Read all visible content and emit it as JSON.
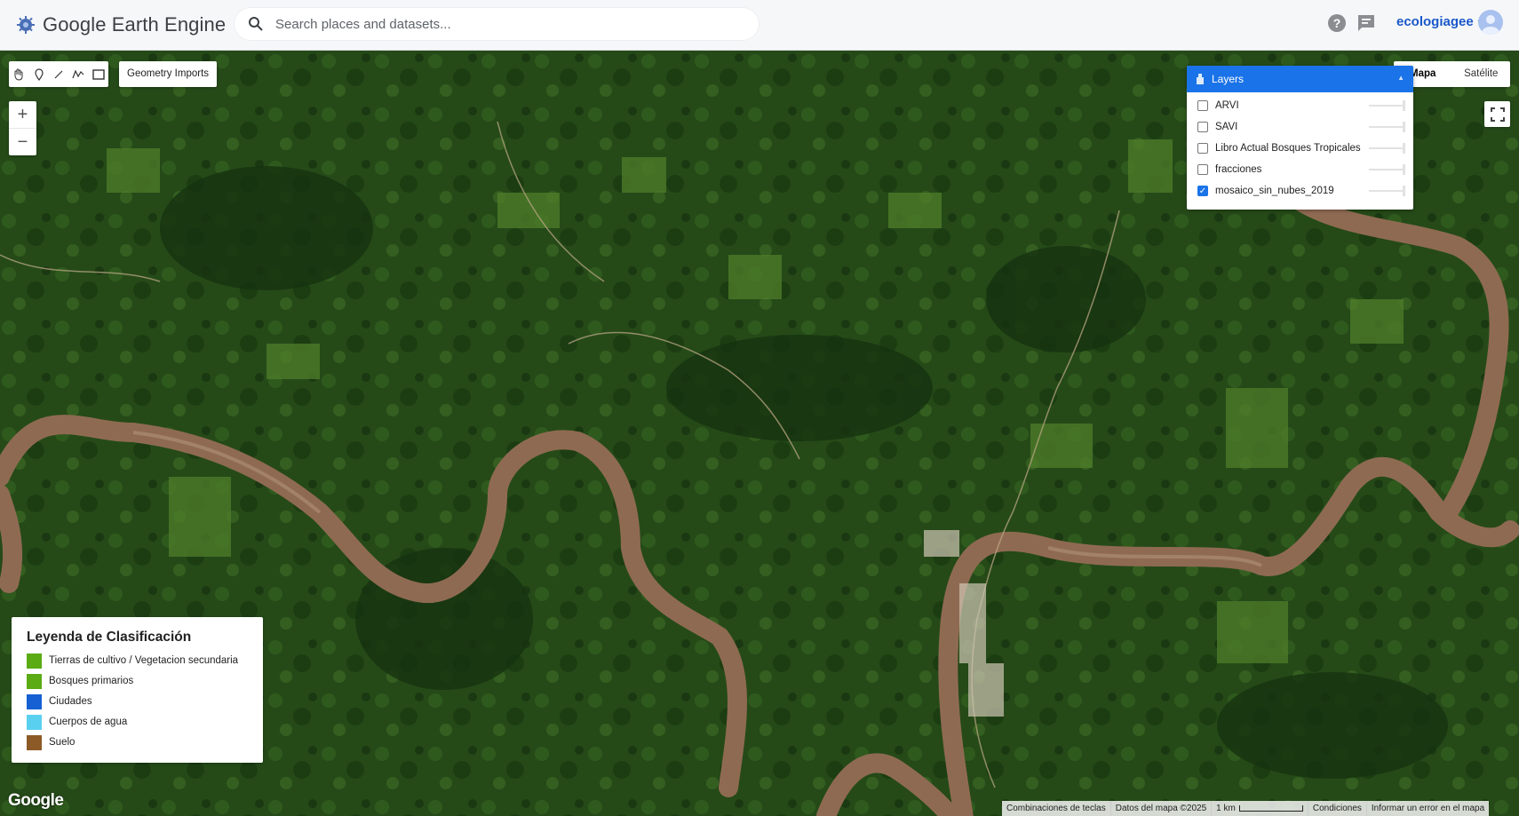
{
  "app": {
    "title": "Google Earth Engine",
    "search_placeholder": "Search places and datasets...",
    "account_name": "ecologiagee",
    "accent_color": "#1a73e8"
  },
  "toolbar": {
    "tools": [
      "pan-hand-icon",
      "point-marker-icon",
      "line-icon",
      "polygon-icon",
      "rectangle-icon"
    ],
    "geometry_imports_label": "Geometry Imports"
  },
  "zoom": {
    "in_label": "+",
    "out_label": "−"
  },
  "map_type": {
    "options": [
      "Mapa",
      "Satélite"
    ],
    "selected": "Mapa"
  },
  "layers": {
    "title": "Layers",
    "items": [
      {
        "name": "ARVI",
        "checked": false
      },
      {
        "name": "SAVI",
        "checked": false
      },
      {
        "name": "Libro Actual Bosques Tropicales",
        "checked": false
      },
      {
        "name": "fracciones",
        "checked": false
      },
      {
        "name": "mosaico_sin_nubes_2019",
        "checked": true
      }
    ]
  },
  "legend": {
    "title": "Leyenda de Clasificación",
    "items": [
      {
        "label": "Tierras de cultivo / Vegetacion secundaria",
        "color": "#5aab14"
      },
      {
        "label": "Bosques primarios",
        "color": "#5aab14"
      },
      {
        "label": "Ciudades",
        "color": "#1660d4"
      },
      {
        "label": "Cuerpos de agua",
        "color": "#5ad0f0"
      },
      {
        "label": "Suelo",
        "color": "#8c5a26"
      }
    ]
  },
  "footer": {
    "google_logo": "Google",
    "keyboard_shortcuts": "Combinaciones de teclas",
    "map_data": "Datos del mapa ©2025",
    "scale": "1 km",
    "terms": "Condiciones",
    "report": "Informar un error en el mapa"
  }
}
